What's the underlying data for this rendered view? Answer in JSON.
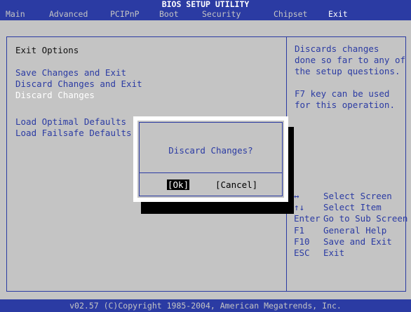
{
  "title": "BIOS SETUP UTILITY",
  "menu": [
    {
      "label": "Main"
    },
    {
      "label": "Advanced"
    },
    {
      "label": "PCIPnP"
    },
    {
      "label": "Boot"
    },
    {
      "label": "Security"
    },
    {
      "label": "Chipset"
    },
    {
      "label": "Exit"
    }
  ],
  "section_title": "Exit Options",
  "options": [
    {
      "label": "Save Changes and Exit"
    },
    {
      "label": "Discard Changes and Exit"
    },
    {
      "label": "Discard Changes"
    },
    {
      "label": "Load Optimal Defaults"
    },
    {
      "label": "Load Failsafe Defaults"
    }
  ],
  "help_lines": [
    "Discards changes",
    "done so far to any of",
    "the setup questions.",
    "",
    "F7 key can be used",
    "for this operation."
  ],
  "keys": [
    {
      "key": "↔",
      "desc": "Select Screen"
    },
    {
      "key": "↑↓",
      "desc": "Select Item"
    },
    {
      "key": "Enter",
      "desc": "Go to Sub Screen"
    },
    {
      "key": "F1",
      "desc": "General Help"
    },
    {
      "key": "F10",
      "desc": "Save and Exit"
    },
    {
      "key": "ESC",
      "desc": "Exit"
    }
  ],
  "dialog": {
    "message": "Discard Changes?",
    "ok_label": "[Ok]",
    "cancel_label": "[Cancel]"
  },
  "footer": "v02.57 (C)Copyright 1985-2004, American Megatrends, Inc.",
  "colors": {
    "bios_blue": "#2b3ba3",
    "bios_gray": "#c4c4c4",
    "highlight_white": "#ffffff"
  }
}
